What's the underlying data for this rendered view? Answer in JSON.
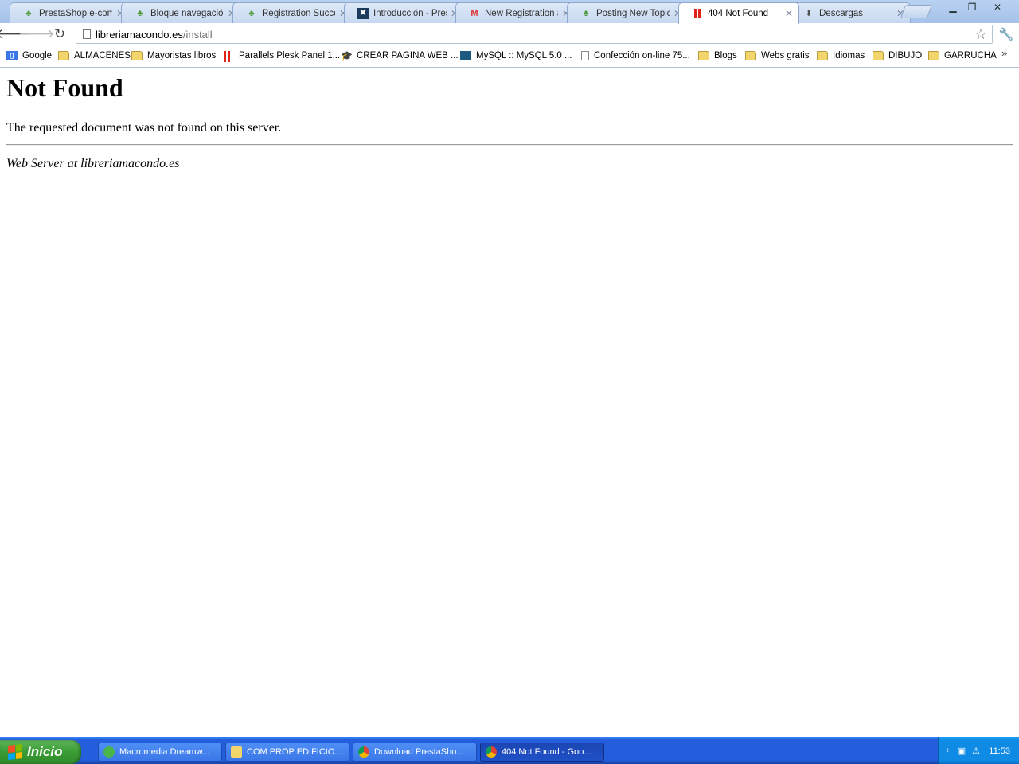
{
  "browser": {
    "tabs": [
      {
        "title": "PrestaShop e-comm",
        "icon": "prestashop-icon"
      },
      {
        "title": "Bloque navegación",
        "icon": "prestashop-icon"
      },
      {
        "title": "Registration Succe",
        "icon": "prestashop-icon"
      },
      {
        "title": "Introducción - Pres",
        "icon": "star-logo-icon"
      },
      {
        "title": "New Registration a",
        "icon": "gmail-icon"
      },
      {
        "title": "Posting New Topic",
        "icon": "prestashop-icon"
      },
      {
        "title": "404 Not Found",
        "icon": "parallels-icon",
        "active": true
      },
      {
        "title": "Descargas",
        "icon": "download-icon"
      }
    ],
    "address": {
      "host": "libreriamacondo.es",
      "path": "/install"
    },
    "bookmarks": [
      {
        "label": "Google",
        "icon": "google-icon"
      },
      {
        "label": "ALMACENES",
        "icon": "folder-icon"
      },
      {
        "label": "Mayoristas libros",
        "icon": "folder-icon"
      },
      {
        "label": "Parallels Plesk Panel 1...",
        "icon": "parallels-icon"
      },
      {
        "label": "CREAR PAGINA WEB ...",
        "icon": "graduation-cap-icon"
      },
      {
        "label": "MySQL :: MySQL 5.0 ...",
        "icon": "mysql-icon"
      },
      {
        "label": "Confección on-line 75...",
        "icon": "page-icon"
      },
      {
        "label": "Blogs",
        "icon": "folder-icon"
      },
      {
        "label": "Webs gratis",
        "icon": "folder-icon"
      },
      {
        "label": "Idiomas",
        "icon": "folder-icon"
      },
      {
        "label": "DIBUJO",
        "icon": "folder-icon"
      },
      {
        "label": "GARRUCHA",
        "icon": "folder-icon"
      }
    ]
  },
  "page": {
    "heading": "Not Found",
    "message": "The requested document was not found on this server.",
    "footer": "Web Server at libreriamacondo.es"
  },
  "taskbar": {
    "start_label": "Inicio",
    "tasks": [
      {
        "label": "Macromedia Dreamw...",
        "icon": "dreamweaver-icon"
      },
      {
        "label": "COM PROP EDIFICIO...",
        "icon": "folder-icon"
      },
      {
        "label": "Download PrestaSho...",
        "icon": "chrome-icon"
      },
      {
        "label": "404 Not Found - Goo...",
        "icon": "chrome-icon",
        "active": true
      }
    ],
    "clock": "11:53"
  },
  "colors": {
    "tabstrip": "#b9d1f1",
    "taskbar": "#245edc",
    "start_button": "#3a9c35",
    "tray": "#0f8be6"
  }
}
